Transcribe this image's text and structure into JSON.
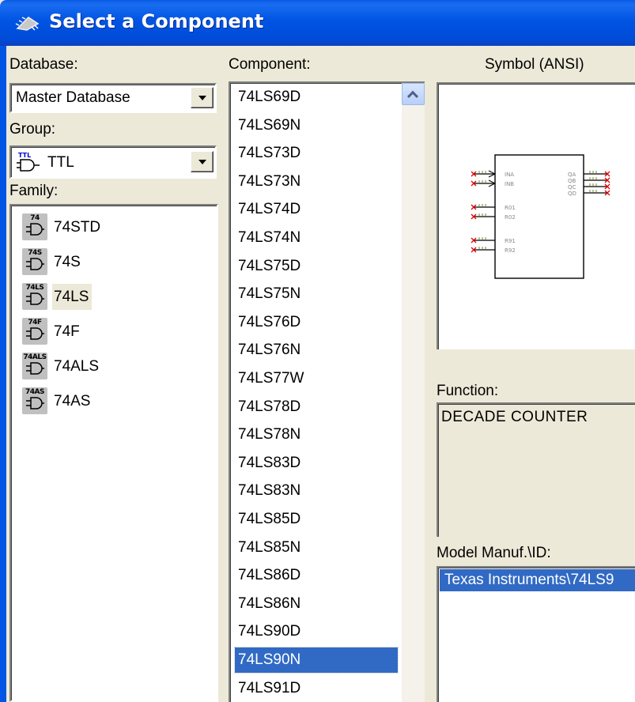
{
  "window": {
    "title": "Select a Component",
    "title_icon": "component-chip-icon"
  },
  "database": {
    "label": "Database:",
    "value": "Master Database"
  },
  "group": {
    "label": "Group:",
    "value": "TTL",
    "icon": "ttl-gate-icon",
    "icon_tag": "TTL"
  },
  "family": {
    "label": "Family:",
    "items": [
      {
        "tag": "74",
        "label": "74STD"
      },
      {
        "tag": "74S",
        "label": "74S"
      },
      {
        "tag": "74LS",
        "label": "74LS"
      },
      {
        "tag": "74F",
        "label": "74F"
      },
      {
        "tag": "74ALS",
        "label": "74ALS"
      },
      {
        "tag": "74AS",
        "label": "74AS"
      }
    ],
    "selected": "74LS"
  },
  "component": {
    "label": "Component:",
    "items": [
      "74LS69D",
      "74LS69N",
      "74LS73D",
      "74LS73N",
      "74LS74D",
      "74LS74N",
      "74LS75D",
      "74LS75N",
      "74LS76D",
      "74LS76N",
      "74LS77W",
      "74LS78D",
      "74LS78N",
      "74LS83D",
      "74LS83N",
      "74LS85D",
      "74LS85N",
      "74LS86D",
      "74LS86N",
      "74LS90D",
      "74LS90N",
      "74LS91D"
    ],
    "selected": "74LS90N"
  },
  "symbol": {
    "label": "Symbol (ANSI)",
    "pins_left": [
      "INA",
      "INB",
      "R01",
      "R02",
      "R91",
      "R92"
    ],
    "pins_right": [
      "QA",
      "QB",
      "QC",
      "QD"
    ]
  },
  "function": {
    "label": "Function:",
    "value": "DECADE COUNTER"
  },
  "model": {
    "label": "Model Manuf.\\ID:",
    "value": "Texas Instruments\\74LS9"
  },
  "colors": {
    "title_bar": "#0054e3",
    "selection": "#316ac5",
    "dialog_bg": "#ece9d8"
  }
}
